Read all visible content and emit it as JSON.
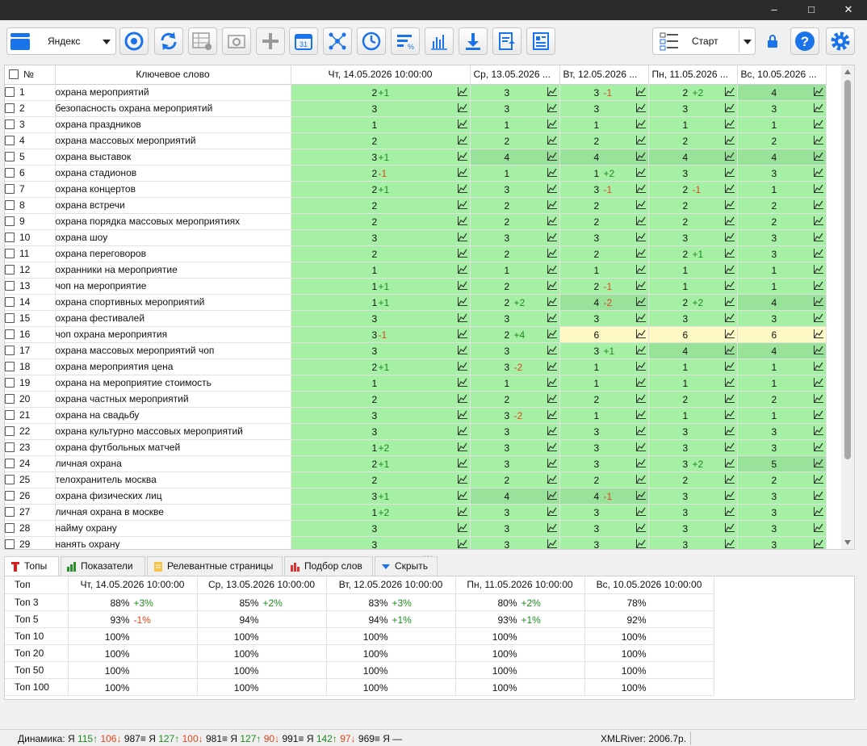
{
  "window": {
    "minimize": "–",
    "maximize": "□",
    "close": "✕"
  },
  "toolbar": {
    "engine_label": "Яндекс",
    "start_label": "Старт",
    "accent": "#1a73e8"
  },
  "grid": {
    "col_num": "№",
    "col_keyword": "Ключевое слово",
    "dates": [
      "Чт, 14.05.2026 10:00:00",
      "Ср, 13.05.2026 ...",
      "Вт, 12.05.2026 ...",
      "Пн, 11.05.2026 ...",
      "Вс, 10.05.2026 ..."
    ],
    "rows": [
      {
        "n": "1",
        "kw": "охрана мероприятий",
        "cells": [
          {
            "v": "2",
            "d": "+1"
          },
          {
            "v": "3",
            "d": ""
          },
          {
            "v": "3",
            "d": "-1"
          },
          {
            "v": "2",
            "d": "+2"
          },
          {
            "v": "4",
            "d": ""
          }
        ]
      },
      {
        "n": "2",
        "kw": "безопасность охрана мероприятий",
        "cells": [
          {
            "v": "3",
            "d": ""
          },
          {
            "v": "3",
            "d": ""
          },
          {
            "v": "3",
            "d": ""
          },
          {
            "v": "3",
            "d": ""
          },
          {
            "v": "3",
            "d": ""
          }
        ]
      },
      {
        "n": "3",
        "kw": "охрана праздников",
        "cells": [
          {
            "v": "1",
            "d": ""
          },
          {
            "v": "1",
            "d": ""
          },
          {
            "v": "1",
            "d": ""
          },
          {
            "v": "1",
            "d": ""
          },
          {
            "v": "1",
            "d": ""
          }
        ]
      },
      {
        "n": "4",
        "kw": "охрана массовых мероприятий",
        "cells": [
          {
            "v": "2",
            "d": ""
          },
          {
            "v": "2",
            "d": ""
          },
          {
            "v": "2",
            "d": ""
          },
          {
            "v": "2",
            "d": ""
          },
          {
            "v": "2",
            "d": ""
          }
        ]
      },
      {
        "n": "5",
        "kw": "охрана выставок",
        "cells": [
          {
            "v": "3",
            "d": "+1"
          },
          {
            "v": "4",
            "d": ""
          },
          {
            "v": "4",
            "d": ""
          },
          {
            "v": "4",
            "d": ""
          },
          {
            "v": "4",
            "d": ""
          }
        ]
      },
      {
        "n": "6",
        "kw": "охрана стадионов",
        "cells": [
          {
            "v": "2",
            "d": "-1"
          },
          {
            "v": "1",
            "d": ""
          },
          {
            "v": "1",
            "d": "+2"
          },
          {
            "v": "3",
            "d": ""
          },
          {
            "v": "3",
            "d": ""
          }
        ]
      },
      {
        "n": "7",
        "kw": "охрана концертов",
        "cells": [
          {
            "v": "2",
            "d": "+1"
          },
          {
            "v": "3",
            "d": ""
          },
          {
            "v": "3",
            "d": "-1"
          },
          {
            "v": "2",
            "d": "-1"
          },
          {
            "v": "1",
            "d": ""
          }
        ]
      },
      {
        "n": "8",
        "kw": "охрана встречи",
        "cells": [
          {
            "v": "2",
            "d": ""
          },
          {
            "v": "2",
            "d": ""
          },
          {
            "v": "2",
            "d": ""
          },
          {
            "v": "2",
            "d": ""
          },
          {
            "v": "2",
            "d": ""
          }
        ]
      },
      {
        "n": "9",
        "kw": "охрана порядка массовых мероприятиях",
        "cells": [
          {
            "v": "2",
            "d": ""
          },
          {
            "v": "2",
            "d": ""
          },
          {
            "v": "2",
            "d": ""
          },
          {
            "v": "2",
            "d": ""
          },
          {
            "v": "2",
            "d": ""
          }
        ]
      },
      {
        "n": "10",
        "kw": "охрана шоу",
        "cells": [
          {
            "v": "3",
            "d": ""
          },
          {
            "v": "3",
            "d": ""
          },
          {
            "v": "3",
            "d": ""
          },
          {
            "v": "3",
            "d": ""
          },
          {
            "v": "3",
            "d": ""
          }
        ]
      },
      {
        "n": "11",
        "kw": "охрана переговоров",
        "cells": [
          {
            "v": "2",
            "d": ""
          },
          {
            "v": "2",
            "d": ""
          },
          {
            "v": "2",
            "d": ""
          },
          {
            "v": "2",
            "d": "+1"
          },
          {
            "v": "3",
            "d": ""
          }
        ]
      },
      {
        "n": "12",
        "kw": "охранники на мероприятие",
        "cells": [
          {
            "v": "1",
            "d": ""
          },
          {
            "v": "1",
            "d": ""
          },
          {
            "v": "1",
            "d": ""
          },
          {
            "v": "1",
            "d": ""
          },
          {
            "v": "1",
            "d": ""
          }
        ]
      },
      {
        "n": "13",
        "kw": "чоп на мероприятие",
        "cells": [
          {
            "v": "1",
            "d": "+1"
          },
          {
            "v": "2",
            "d": ""
          },
          {
            "v": "2",
            "d": "-1"
          },
          {
            "v": "1",
            "d": ""
          },
          {
            "v": "1",
            "d": ""
          }
        ]
      },
      {
        "n": "14",
        "kw": "охрана спортивных мероприятий",
        "cells": [
          {
            "v": "1",
            "d": "+1"
          },
          {
            "v": "2",
            "d": "+2"
          },
          {
            "v": "4",
            "d": "-2"
          },
          {
            "v": "2",
            "d": "+2"
          },
          {
            "v": "4",
            "d": ""
          }
        ]
      },
      {
        "n": "15",
        "kw": "охрана фестивалей",
        "cells": [
          {
            "v": "3",
            "d": ""
          },
          {
            "v": "3",
            "d": ""
          },
          {
            "v": "3",
            "d": ""
          },
          {
            "v": "3",
            "d": ""
          },
          {
            "v": "3",
            "d": ""
          }
        ]
      },
      {
        "n": "16",
        "kw": "чоп охрана мероприятия",
        "cells": [
          {
            "v": "3",
            "d": "-1"
          },
          {
            "v": "2",
            "d": "+4"
          },
          {
            "v": "6",
            "d": ""
          },
          {
            "v": "6",
            "d": ""
          },
          {
            "v": "6",
            "d": ""
          }
        ]
      },
      {
        "n": "17",
        "kw": "охрана массовых мероприятий чоп",
        "cells": [
          {
            "v": "3",
            "d": ""
          },
          {
            "v": "3",
            "d": ""
          },
          {
            "v": "3",
            "d": "+1"
          },
          {
            "v": "4",
            "d": ""
          },
          {
            "v": "4",
            "d": ""
          }
        ]
      },
      {
        "n": "18",
        "kw": "охрана мероприятия цена",
        "cells": [
          {
            "v": "2",
            "d": "+1"
          },
          {
            "v": "3",
            "d": "-2"
          },
          {
            "v": "1",
            "d": ""
          },
          {
            "v": "1",
            "d": ""
          },
          {
            "v": "1",
            "d": ""
          }
        ]
      },
      {
        "n": "19",
        "kw": "охрана на мероприятие стоимость",
        "cells": [
          {
            "v": "1",
            "d": ""
          },
          {
            "v": "1",
            "d": ""
          },
          {
            "v": "1",
            "d": ""
          },
          {
            "v": "1",
            "d": ""
          },
          {
            "v": "1",
            "d": ""
          }
        ]
      },
      {
        "n": "20",
        "kw": "охрана частных мероприятий",
        "cells": [
          {
            "v": "2",
            "d": ""
          },
          {
            "v": "2",
            "d": ""
          },
          {
            "v": "2",
            "d": ""
          },
          {
            "v": "2",
            "d": ""
          },
          {
            "v": "2",
            "d": ""
          }
        ]
      },
      {
        "n": "21",
        "kw": "охрана на свадьбу",
        "cells": [
          {
            "v": "3",
            "d": ""
          },
          {
            "v": "3",
            "d": "-2"
          },
          {
            "v": "1",
            "d": ""
          },
          {
            "v": "1",
            "d": ""
          },
          {
            "v": "1",
            "d": ""
          }
        ]
      },
      {
        "n": "22",
        "kw": "охрана культурно массовых мероприятий",
        "cells": [
          {
            "v": "3",
            "d": ""
          },
          {
            "v": "3",
            "d": ""
          },
          {
            "v": "3",
            "d": ""
          },
          {
            "v": "3",
            "d": ""
          },
          {
            "v": "3",
            "d": ""
          }
        ]
      },
      {
        "n": "23",
        "kw": "охрана футбольных матчей",
        "cells": [
          {
            "v": "1",
            "d": "+2"
          },
          {
            "v": "3",
            "d": ""
          },
          {
            "v": "3",
            "d": ""
          },
          {
            "v": "3",
            "d": ""
          },
          {
            "v": "3",
            "d": ""
          }
        ]
      },
      {
        "n": "24",
        "kw": "личная охрана",
        "cells": [
          {
            "v": "2",
            "d": "+1"
          },
          {
            "v": "3",
            "d": ""
          },
          {
            "v": "3",
            "d": ""
          },
          {
            "v": "3",
            "d": "+2"
          },
          {
            "v": "5",
            "d": ""
          }
        ]
      },
      {
        "n": "25",
        "kw": "телохранитель москва",
        "cells": [
          {
            "v": "2",
            "d": ""
          },
          {
            "v": "2",
            "d": ""
          },
          {
            "v": "2",
            "d": ""
          },
          {
            "v": "2",
            "d": ""
          },
          {
            "v": "2",
            "d": ""
          }
        ]
      },
      {
        "n": "26",
        "kw": "охрана физических лиц",
        "cells": [
          {
            "v": "3",
            "d": "+1"
          },
          {
            "v": "4",
            "d": ""
          },
          {
            "v": "4",
            "d": "-1"
          },
          {
            "v": "3",
            "d": ""
          },
          {
            "v": "3",
            "d": ""
          }
        ]
      },
      {
        "n": "27",
        "kw": "личная охрана в москве",
        "cells": [
          {
            "v": "1",
            "d": "+2"
          },
          {
            "v": "3",
            "d": ""
          },
          {
            "v": "3",
            "d": ""
          },
          {
            "v": "3",
            "d": ""
          },
          {
            "v": "3",
            "d": ""
          }
        ]
      },
      {
        "n": "28",
        "kw": "найму охрану",
        "cells": [
          {
            "v": "3",
            "d": ""
          },
          {
            "v": "3",
            "d": ""
          },
          {
            "v": "3",
            "d": ""
          },
          {
            "v": "3",
            "d": ""
          },
          {
            "v": "3",
            "d": ""
          }
        ]
      },
      {
        "n": "29",
        "kw": "нанять охрану",
        "cells": [
          {
            "v": "3",
            "d": ""
          },
          {
            "v": "3",
            "d": ""
          },
          {
            "v": "3",
            "d": ""
          },
          {
            "v": "3",
            "d": ""
          },
          {
            "v": "3",
            "d": ""
          }
        ]
      }
    ]
  },
  "tabs": [
    "Топы",
    "Показатели",
    "Релевантные страницы",
    "Подбор слов",
    "Скрыть"
  ],
  "tops": {
    "header_label": "Топ",
    "dates": [
      "Чт, 14.05.2026 10:00:00",
      "Ср, 13.05.2026 10:00:00",
      "Вт, 12.05.2026 10:00:00",
      "Пн, 11.05.2026 10:00:00",
      "Вс, 10.05.2026 10:00:00"
    ],
    "rows": [
      {
        "label": "Топ 3",
        "cells": [
          {
            "v": "88%",
            "d": "+3%"
          },
          {
            "v": "85%",
            "d": "+2%"
          },
          {
            "v": "83%",
            "d": "+3%"
          },
          {
            "v": "80%",
            "d": "+2%"
          },
          {
            "v": "78%",
            "d": ""
          }
        ]
      },
      {
        "label": "Топ 5",
        "cells": [
          {
            "v": "93%",
            "d": "-1%"
          },
          {
            "v": "94%",
            "d": ""
          },
          {
            "v": "94%",
            "d": "+1%"
          },
          {
            "v": "93%",
            "d": "+1%"
          },
          {
            "v": "92%",
            "d": ""
          }
        ]
      },
      {
        "label": "Топ 10",
        "cells": [
          {
            "v": "100%",
            "d": ""
          },
          {
            "v": "100%",
            "d": ""
          },
          {
            "v": "100%",
            "d": ""
          },
          {
            "v": "100%",
            "d": ""
          },
          {
            "v": "100%",
            "d": ""
          }
        ]
      },
      {
        "label": "Топ 20",
        "cells": [
          {
            "v": "100%",
            "d": ""
          },
          {
            "v": "100%",
            "d": ""
          },
          {
            "v": "100%",
            "d": ""
          },
          {
            "v": "100%",
            "d": ""
          },
          {
            "v": "100%",
            "d": ""
          }
        ]
      },
      {
        "label": "Топ 50",
        "cells": [
          {
            "v": "100%",
            "d": ""
          },
          {
            "v": "100%",
            "d": ""
          },
          {
            "v": "100%",
            "d": ""
          },
          {
            "v": "100%",
            "d": ""
          },
          {
            "v": "100%",
            "d": ""
          }
        ]
      },
      {
        "label": "Топ 100",
        "cells": [
          {
            "v": "100%",
            "d": ""
          },
          {
            "v": "100%",
            "d": ""
          },
          {
            "v": "100%",
            "d": ""
          },
          {
            "v": "100%",
            "d": ""
          },
          {
            "v": "100%",
            "d": ""
          }
        ]
      }
    ]
  },
  "status": {
    "dynamics_label": "Динамика:",
    "items": [
      {
        "e": "Я",
        "up": "115↑",
        "down": "106↓",
        "eq": "987≡"
      },
      {
        "e": "Я",
        "up": "127↑",
        "down": "100↓",
        "eq": "981≡"
      },
      {
        "e": "Я",
        "up": "127↑",
        "down": "90↓",
        "eq": "991≡"
      },
      {
        "e": "Я",
        "up": "142↑",
        "down": "97↓",
        "eq": "969≡"
      }
    ],
    "tail": "Я —",
    "balance": "XMLRiver: 2006.7р."
  }
}
